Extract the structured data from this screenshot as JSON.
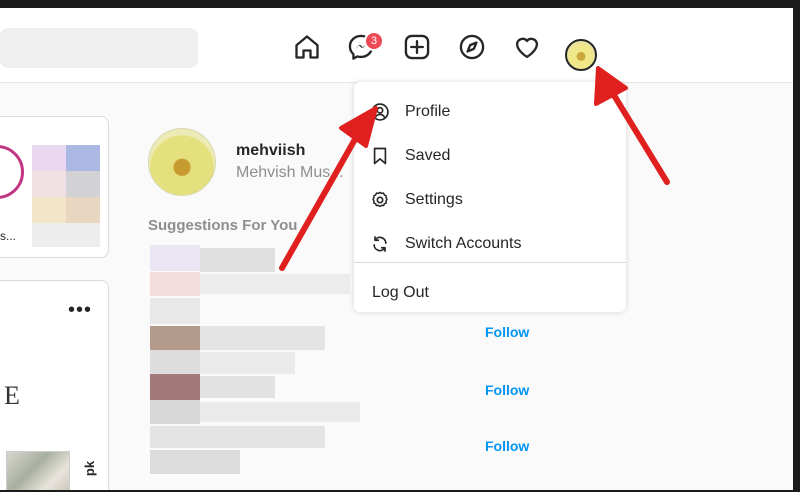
{
  "nav": {
    "messenger_badge": "3",
    "icons": [
      "home-icon",
      "messenger-icon",
      "new-post-icon",
      "explore-icon",
      "activity-heart-icon",
      "profile-avatar"
    ]
  },
  "profile": {
    "username": "mehviish",
    "full_name": "Mehvish Mus..."
  },
  "sidebar": {
    "suggestions_title": "Suggestions For You",
    "follow_label": "Follow"
  },
  "stories": {
    "caption": "s..."
  },
  "post": {
    "more": "•••",
    "side_text": "pk"
  },
  "dropdown": {
    "items": [
      {
        "label": "Profile",
        "icon": "profile-icon"
      },
      {
        "label": "Saved",
        "icon": "bookmark-icon"
      },
      {
        "label": "Settings",
        "icon": "settings-icon"
      },
      {
        "label": "Switch Accounts",
        "icon": "switch-accounts-icon"
      }
    ],
    "logout": "Log Out"
  },
  "colors": {
    "accent": "#0095f6",
    "badge": "#ed4956",
    "annotation_arrow": "#e0201f"
  }
}
